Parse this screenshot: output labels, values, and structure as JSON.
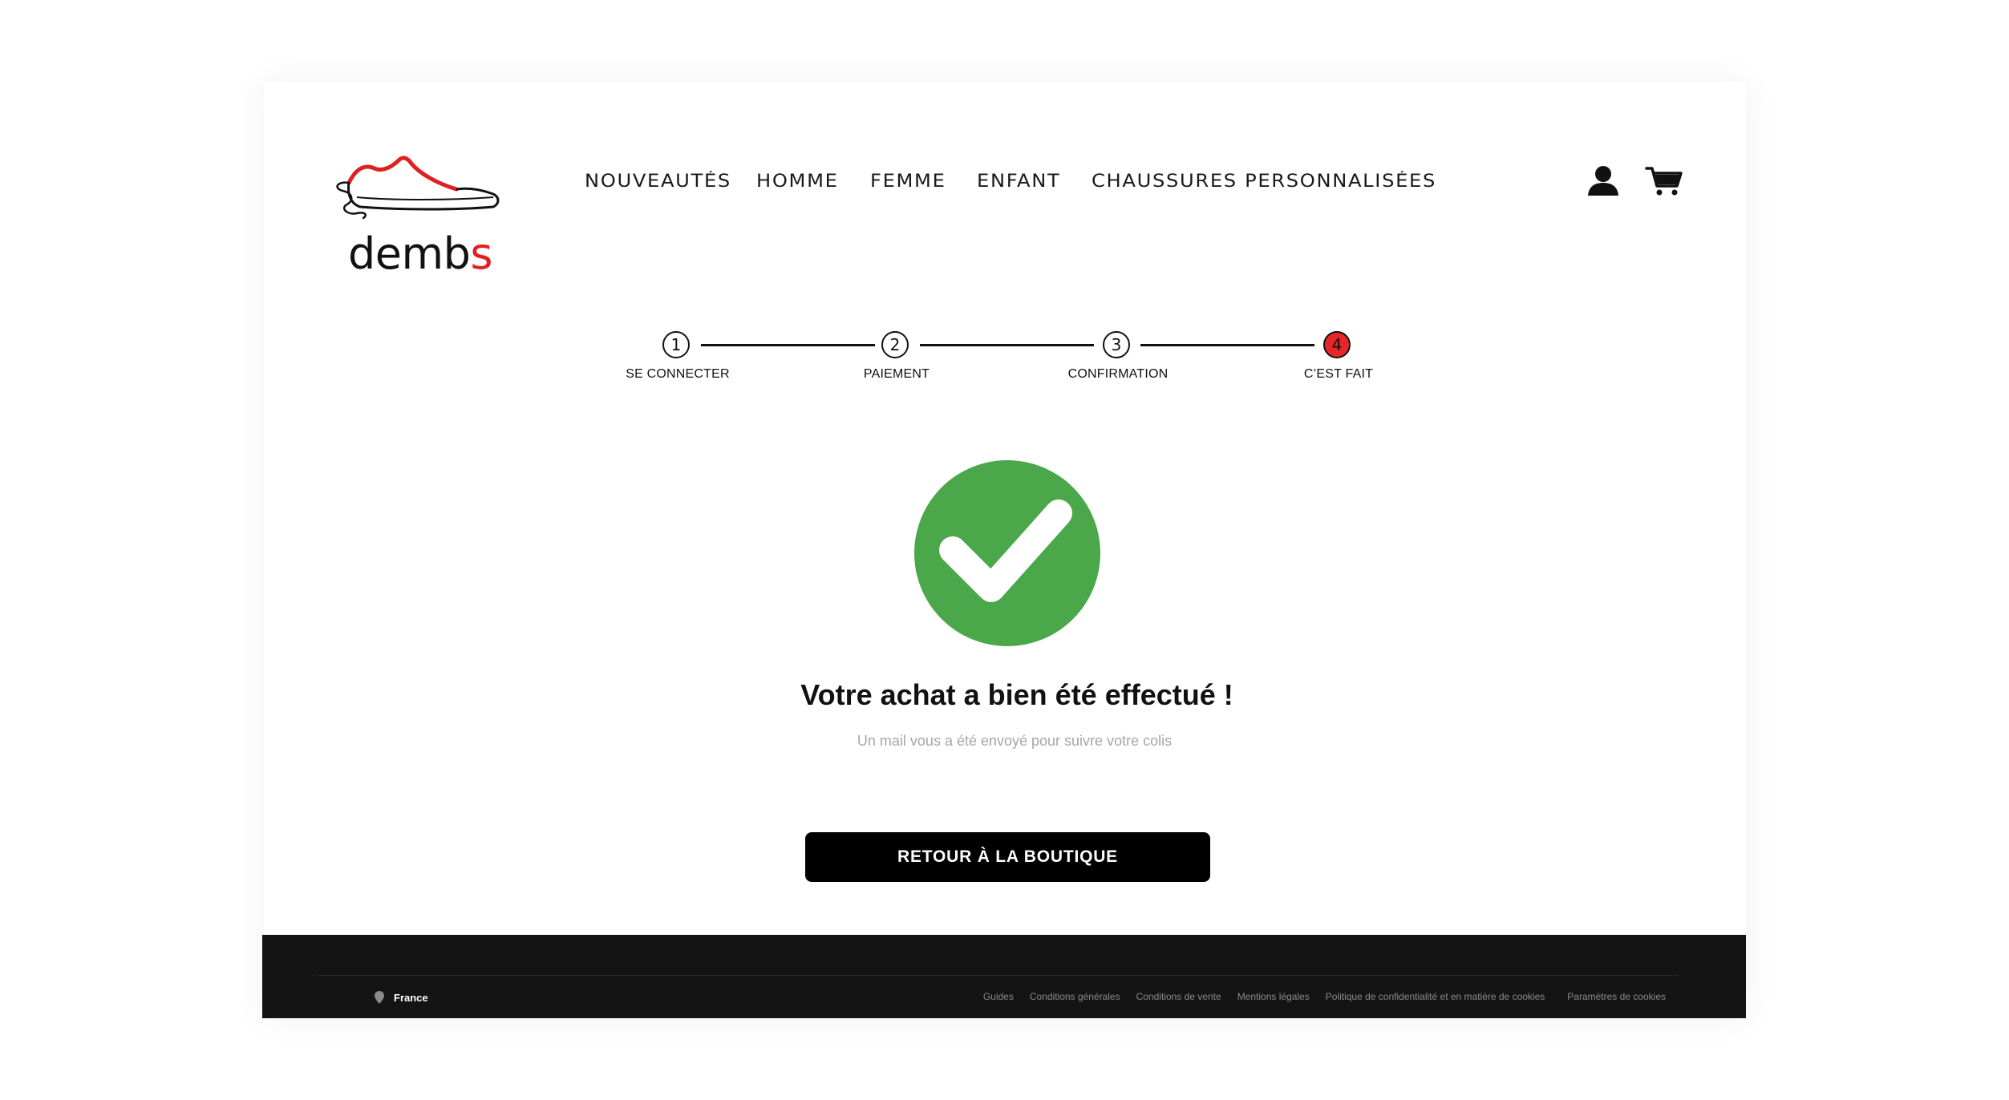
{
  "brand": {
    "logo_text_main": "demb",
    "logo_text_accent": "s",
    "accent_color": "#e02020"
  },
  "nav": {
    "items": [
      {
        "label": "NOUVEAUTÉS"
      },
      {
        "label": "HOMME"
      },
      {
        "label": "FEMME"
      },
      {
        "label": "ENFANT"
      },
      {
        "label": "CHAUSSURES PERSONNALISÉES"
      }
    ]
  },
  "header_icons": {
    "account": "user-icon",
    "cart": "cart-icon"
  },
  "stepper": {
    "steps": [
      {
        "number": "1",
        "label": "SE CONNECTER",
        "active": false
      },
      {
        "number": "2",
        "label": "PAIEMENT",
        "active": false
      },
      {
        "number": "3",
        "label": "CONFIRMATION",
        "active": false
      },
      {
        "number": "4",
        "label": "C’EST FAIT",
        "active": true
      }
    ],
    "active_color": "#e8262a"
  },
  "success": {
    "icon": "check-circle-icon",
    "icon_color": "#4aa84a",
    "title": "Votre achat a bien été effectué !",
    "subtitle": "Un mail vous a été envoyé pour suivre votre colis",
    "button_label": "RETOUR À LA BOUTIQUE"
  },
  "footer": {
    "country": "France",
    "links": [
      {
        "label": "Guides"
      },
      {
        "label": "Conditions générales"
      },
      {
        "label": "Conditions de vente"
      },
      {
        "label": "Mentions légales"
      },
      {
        "label": "Politique de confidentialité et en matière de cookies"
      },
      {
        "label": "Paramètres de cookies"
      }
    ]
  }
}
